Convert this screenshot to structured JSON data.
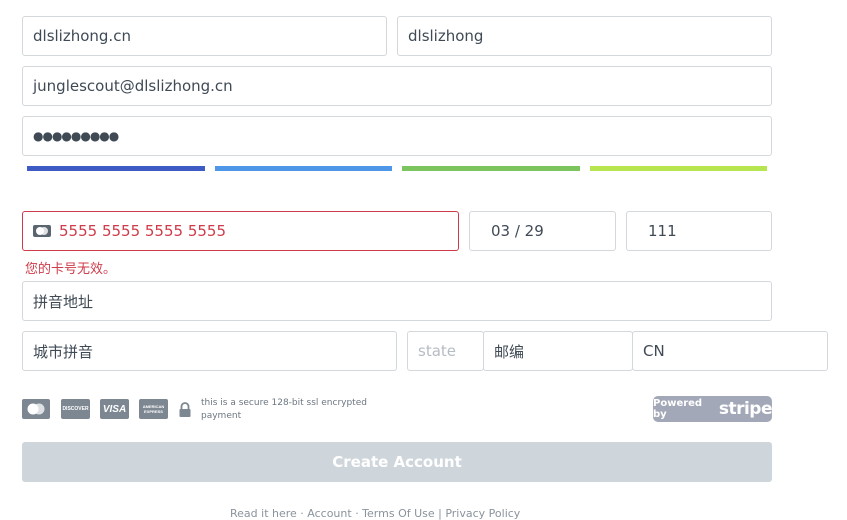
{
  "form": {
    "company_value": "dlslizhong.cn",
    "username_value": "dlslizhong",
    "email_value": "junglescout@dlslizhong.cn",
    "password_value": "●●●●●●●●●"
  },
  "strength": {
    "colors": [
      "#3e5bc4",
      "#4d96e8",
      "#7cc45e",
      "#b6e550"
    ]
  },
  "card": {
    "number_value": "5555 5555 5555 5555",
    "expiry_value": "03 / 29",
    "cvc_value": "111",
    "error_message": "您的卡号无效。"
  },
  "address": {
    "street_value": "拼音地址",
    "city_value": "城市拼音",
    "state_placeholder": "state",
    "zip_value": "邮编",
    "country_value": "CN"
  },
  "payment": {
    "logos": [
      "mastercard-icon",
      "discover-icon",
      "visa-icon",
      "amex-icon"
    ],
    "discover_label": "DISCOVER",
    "visa_label": "VISA",
    "amex_label": "AMERICAN EXPRESS",
    "secure_text": "this is a secure 128-bit ssl encrypted payment",
    "powered_by": "Powered by",
    "stripe": "stripe"
  },
  "actions": {
    "create_account_label": "Create Account"
  },
  "footer": {
    "text": "Read it here · Account · Terms Of Use | Privacy Policy"
  }
}
